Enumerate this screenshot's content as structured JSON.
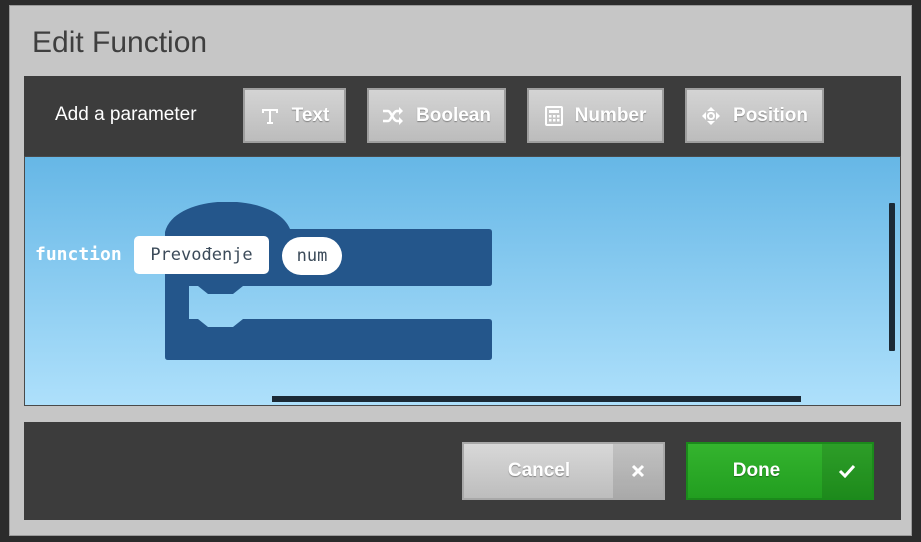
{
  "dialog": {
    "title": "Edit Function"
  },
  "params": {
    "label": "Add a parameter",
    "buttons": [
      {
        "label": "Text",
        "icon": "text-icon"
      },
      {
        "label": "Boolean",
        "icon": "shuffle-icon"
      },
      {
        "label": "Number",
        "icon": "calculator-icon"
      },
      {
        "label": "Position",
        "icon": "move-icon"
      }
    ]
  },
  "block": {
    "keyword": "function",
    "name": "Prevođenje",
    "param": "num",
    "color": "#24568b"
  },
  "footer": {
    "cancel_label": "Cancel",
    "done_label": "Done",
    "done_color": "#2aa72a"
  }
}
